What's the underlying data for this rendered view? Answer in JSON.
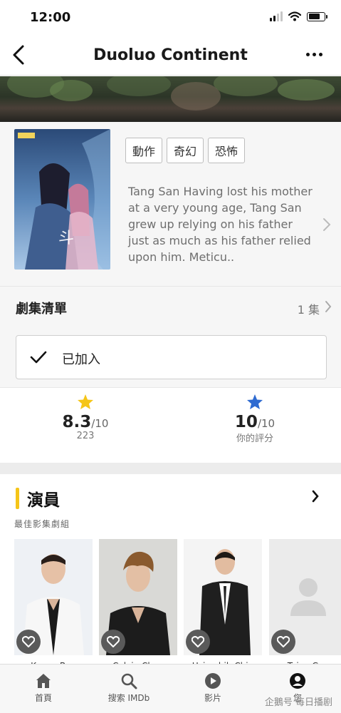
{
  "status_bar": {
    "time": "12:00"
  },
  "nav": {
    "title": "Duoluo Continent"
  },
  "info": {
    "genres": [
      "動作",
      "奇幻",
      "恐怖"
    ],
    "synopsis": "Tang San Having lost his mother at a very young age, Tang San grew up relying on his father just as much as his father relied upon him. Meticu.."
  },
  "episodes": {
    "label": "劇集清單",
    "count": "1 集",
    "added_label": "已加入"
  },
  "ratings": {
    "imdb": {
      "score": "8.3",
      "scale": "/10",
      "votes": "223",
      "star_color": "#f5c518"
    },
    "user": {
      "score": "10",
      "scale": "/10",
      "label": "你的評分",
      "star_color": "#2f6bd1"
    }
  },
  "cast": {
    "heading": "演員",
    "subheading": "最佳影集劇組",
    "members": [
      {
        "name": "Kenny Bee"
      },
      {
        "name": "Calvin Chen"
      },
      {
        "name": "Hsin-chih Chiu"
      },
      {
        "name": "Taiyu Gao"
      }
    ]
  },
  "tabs": [
    {
      "label": "首頁",
      "icon": "home-icon"
    },
    {
      "label": "搜索 IMDb",
      "icon": "search-icon"
    },
    {
      "label": "影片",
      "icon": "play-icon"
    },
    {
      "label": "您",
      "icon": "profile-icon"
    }
  ],
  "watermark": "企鵝号 每日播剧",
  "colors": {
    "accent": "#f5c518",
    "user_star": "#2f6bd1"
  }
}
